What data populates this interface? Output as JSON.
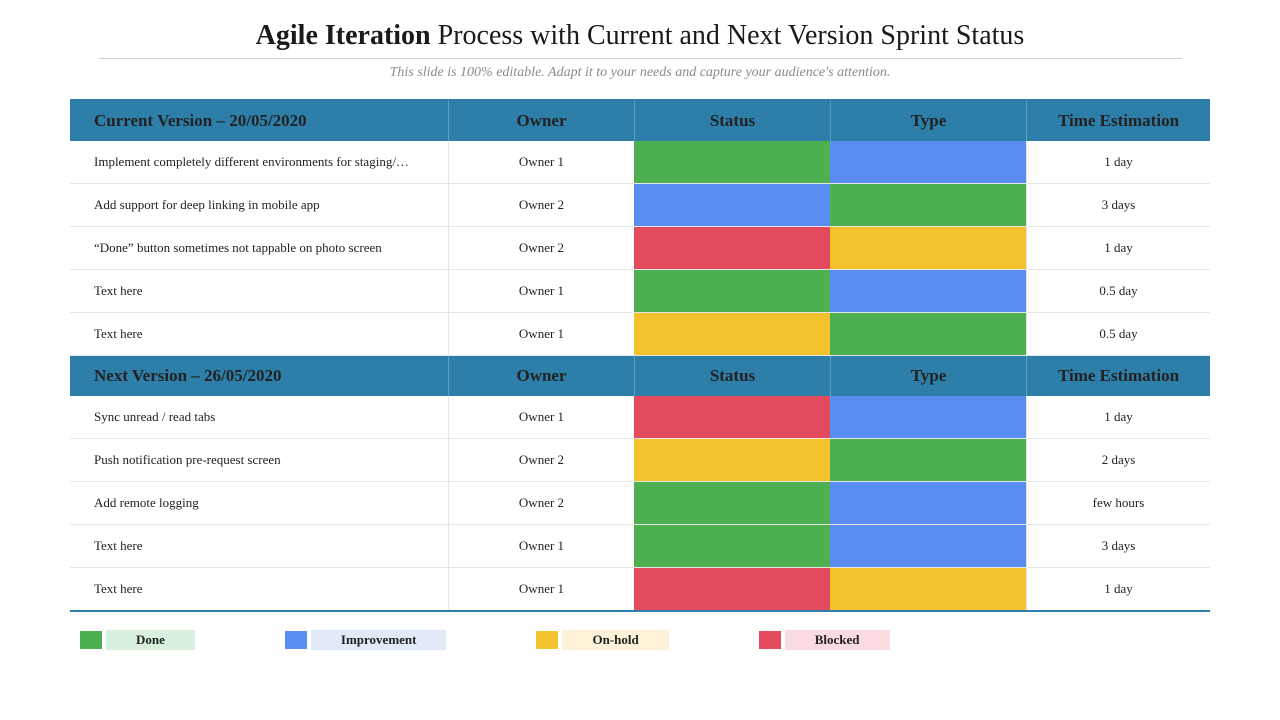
{
  "title_bold": "Agile Iteration",
  "title_rest": " Process with Current and Next Version Sprint Status",
  "subtitle": "This slide is 100% editable. Adapt it to your needs and capture your audience's attention.",
  "colors": {
    "green": "#4cb050",
    "blue": "#5a8df0",
    "red": "#e44a5d",
    "yellow": "#f3c22c"
  },
  "sections": [
    {
      "header": {
        "task": "Current Version – 20/05/2020",
        "owner": "Owner",
        "status": "Status",
        "type": "Type",
        "time": "Time Estimation"
      },
      "rows": [
        {
          "task": "Implement completely different environments for staging/…",
          "owner": "Owner 1",
          "status": "green",
          "type": "blue",
          "time": "1 day"
        },
        {
          "task": "Add support for deep linking in mobile app",
          "owner": "Owner 2",
          "status": "blue",
          "type": "green",
          "time": "3 days"
        },
        {
          "task": "“Done” button sometimes not tappable on photo screen",
          "owner": "Owner 2",
          "status": "red",
          "type": "yellow",
          "time": "1 day"
        },
        {
          "task": "Text here",
          "owner": "Owner 1",
          "status": "green",
          "type": "blue",
          "time": "0.5 day"
        },
        {
          "task": "Text here",
          "owner": "Owner 1",
          "status": "yellow",
          "type": "green",
          "time": "0.5 day"
        }
      ]
    },
    {
      "header": {
        "task": "Next Version – 26/05/2020",
        "owner": "Owner",
        "status": "Status",
        "type": "Type",
        "time": "Time Estimation"
      },
      "rows": [
        {
          "task": "Sync unread / read tabs",
          "owner": "Owner 1",
          "status": "red",
          "type": "blue",
          "time": "1 day"
        },
        {
          "task": "Push notification pre-request screen",
          "owner": "Owner 2",
          "status": "yellow",
          "type": "green",
          "time": "2 days"
        },
        {
          "task": "Add remote logging",
          "owner": "Owner 2",
          "status": "green",
          "type": "blue",
          "time": "few hours"
        },
        {
          "task": "Text here",
          "owner": "Owner 1",
          "status": "green",
          "type": "blue",
          "time": "3 days"
        },
        {
          "task": "Text here",
          "owner": "Owner 1",
          "status": "red",
          "type": "yellow",
          "time": "1 day"
        }
      ]
    }
  ],
  "legend": [
    {
      "color": "green",
      "label": "Done"
    },
    {
      "color": "blue",
      "label": "Improvement"
    },
    {
      "color": "yellow",
      "label": "On-hold"
    },
    {
      "color": "red",
      "label": "Blocked"
    }
  ]
}
